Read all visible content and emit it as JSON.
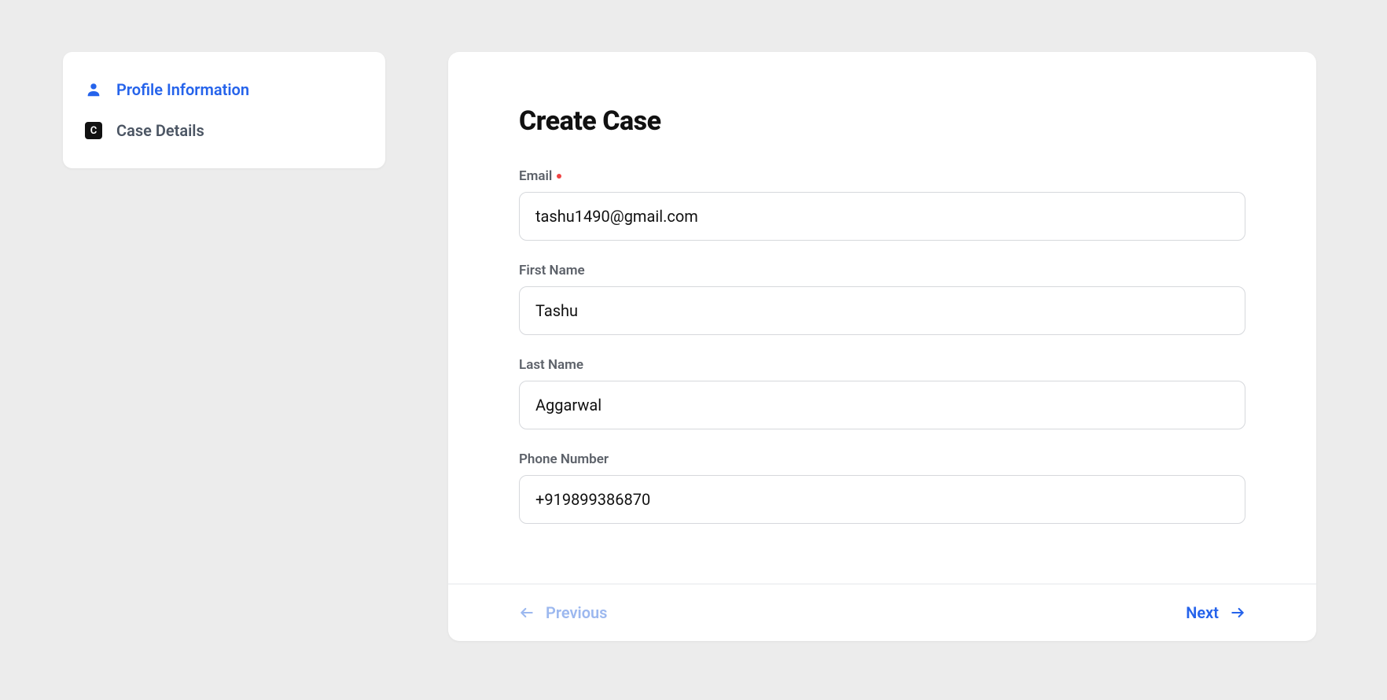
{
  "sidebar": {
    "items": [
      {
        "label": "Profile Information"
      },
      {
        "label": "Case Details"
      }
    ]
  },
  "main": {
    "title": "Create Case",
    "fields": {
      "email": {
        "label": "Email",
        "value": "tashu1490@gmail.com",
        "required": true
      },
      "first_name": {
        "label": "First Name",
        "value": "Tashu",
        "required": false
      },
      "last_name": {
        "label": "Last Name",
        "value": "Aggarwal",
        "required": false
      },
      "phone": {
        "label": "Phone Number",
        "value": "+919899386870",
        "required": false
      }
    }
  },
  "footer": {
    "previous": "Previous",
    "next": "Next"
  }
}
